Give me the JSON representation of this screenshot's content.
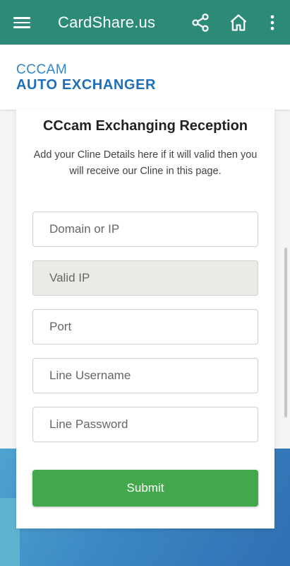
{
  "appbar": {
    "title": "CardShare.us",
    "icons": [
      "menu-icon",
      "share-icon",
      "home-icon",
      "more-vert-icon"
    ],
    "color": "#2b8a78"
  },
  "brand": {
    "line1": "CCCAM",
    "line2": "AUTO EXCHANGER"
  },
  "form": {
    "heading": "CCcam Exchanging Reception",
    "description": "Add your Cline Details here if it will valid then you will receive our Cline in this page.",
    "fields": [
      {
        "placeholder": "Domain or IP",
        "value": ""
      },
      {
        "placeholder": "Valid IP",
        "value": ""
      },
      {
        "placeholder": "Port",
        "value": ""
      },
      {
        "placeholder": "Line Username",
        "value": ""
      },
      {
        "placeholder": "Line Password",
        "value": ""
      }
    ],
    "submit_label": "Submit",
    "submit_color": "#42a84b"
  }
}
